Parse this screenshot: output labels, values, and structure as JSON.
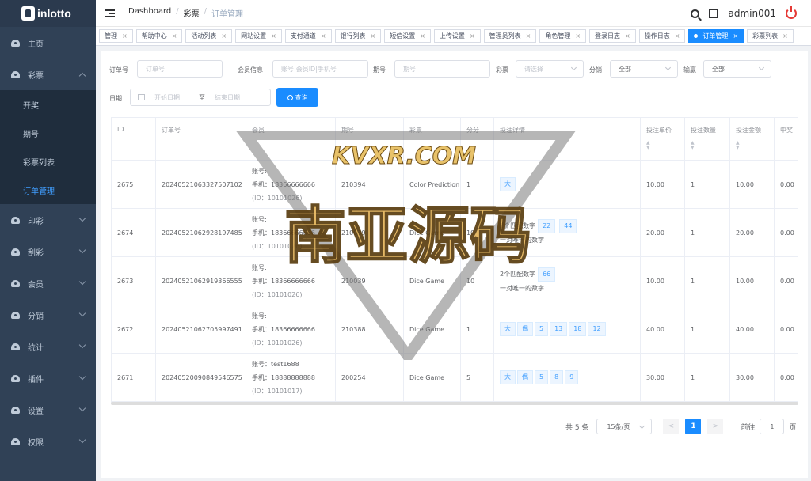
{
  "app": {
    "name": "inlotto"
  },
  "sidebar": {
    "items": [
      {
        "label": "主页",
        "icon": "dashboard-icon",
        "has_arrow": false
      },
      {
        "label": "彩票",
        "icon": "dashboard-icon",
        "has_arrow": true,
        "expanded": true,
        "children": [
          {
            "label": "开奖",
            "active": false
          },
          {
            "label": "期号",
            "active": false
          },
          {
            "label": "彩票列表",
            "active": false
          },
          {
            "label": "订单管理",
            "active": true
          }
        ]
      },
      {
        "label": "印彩",
        "icon": "dashboard-icon",
        "has_arrow": true
      },
      {
        "label": "刮彩",
        "icon": "dashboard-icon",
        "has_arrow": true
      },
      {
        "label": "会员",
        "icon": "dashboard-icon",
        "has_arrow": true
      },
      {
        "label": "分销",
        "icon": "dashboard-icon",
        "has_arrow": true
      },
      {
        "label": "统计",
        "icon": "dashboard-icon",
        "has_arrow": true
      },
      {
        "label": "插件",
        "icon": "dashboard-icon",
        "has_arrow": true
      },
      {
        "label": "设置",
        "icon": "dashboard-icon",
        "has_arrow": true
      },
      {
        "label": "权限",
        "icon": "dashboard-icon",
        "has_arrow": true
      }
    ]
  },
  "navbar": {
    "breadcrumb": [
      "Dashboard",
      "彩票",
      "订单管理"
    ],
    "user": "admin001"
  },
  "tags": [
    {
      "label": "管理",
      "active": false
    },
    {
      "label": "帮助中心",
      "active": false
    },
    {
      "label": "活动列表",
      "active": false
    },
    {
      "label": "网站设置",
      "active": false
    },
    {
      "label": "支付通道",
      "active": false
    },
    {
      "label": "银行列表",
      "active": false
    },
    {
      "label": "短信设置",
      "active": false
    },
    {
      "label": "上传设置",
      "active": false
    },
    {
      "label": "管理员列表",
      "active": false
    },
    {
      "label": "角色管理",
      "active": false
    },
    {
      "label": "登录日志",
      "active": false
    },
    {
      "label": "操作日志",
      "active": false
    },
    {
      "label": "订单管理",
      "active": true
    },
    {
      "label": "彩票列表",
      "active": false
    }
  ],
  "filters": {
    "order_no": {
      "label": "订单号",
      "placeholder": "订单号"
    },
    "member": {
      "label": "会员信息",
      "placeholder": "账号|会员ID|手机号"
    },
    "issue": {
      "label": "期号",
      "placeholder": "期号"
    },
    "lottery": {
      "label": "彩票",
      "placeholder": "请选择"
    },
    "distribution": {
      "label": "分销",
      "value": "全部"
    },
    "win": {
      "label": "输赢",
      "value": "全部"
    },
    "date": {
      "label": "日期",
      "start_placeholder": "开始日期",
      "separator": "至",
      "end_placeholder": "结束日期"
    },
    "search_button": "查询"
  },
  "table": {
    "columns": [
      "ID",
      "订单号",
      "会员",
      "期号",
      "彩票",
      "分分",
      "投注详情",
      "投注单价",
      "投注数量",
      "投注金额",
      "中奖"
    ],
    "rows": [
      {
        "id": "2675",
        "order_no": "20240521063327507102",
        "member": [
          "账号:",
          "手机：18366666666",
          "(ID：10101026)"
        ],
        "issue": "210394",
        "lottery": "Color Prediction",
        "fen": "1",
        "detail_lines": [],
        "badges": [
          "大"
        ],
        "price": "10.00",
        "qty": "1",
        "amount": "10.00",
        "win": "0.00"
      },
      {
        "id": "2674",
        "order_no": "20240521062928197485",
        "member": [
          "账号:",
          "手机：18366666666",
          "(ID：10101026)"
        ],
        "issue": "210039",
        "lottery": "Dice Game",
        "fen": "10",
        "detail_lines": [
          "2个匹配数字",
          "一对唯一的数字"
        ],
        "badges": [
          "22",
          "44"
        ],
        "price": "20.00",
        "qty": "1",
        "amount": "20.00",
        "win": "0.00"
      },
      {
        "id": "2673",
        "order_no": "20240521062919366555",
        "member": [
          "账号:",
          "手机：18366666666",
          "(ID：10101026)"
        ],
        "issue": "210039",
        "lottery": "Dice Game",
        "fen": "10",
        "detail_lines": [
          "2个匹配数字",
          "一对唯一的数字"
        ],
        "badges": [
          "66"
        ],
        "price": "10.00",
        "qty": "1",
        "amount": "10.00",
        "win": "0.00"
      },
      {
        "id": "2672",
        "order_no": "20240521062705997491",
        "member": [
          "账号:",
          "手机：18366666666",
          "(ID：10101026)"
        ],
        "issue": "210388",
        "lottery": "Dice Game",
        "fen": "1",
        "detail_lines": [],
        "badges": [
          "大",
          "偶",
          "5",
          "13",
          "18",
          "12"
        ],
        "price": "40.00",
        "qty": "1",
        "amount": "40.00",
        "win": "0.00"
      },
      {
        "id": "2671",
        "order_no": "20240520090849546575",
        "member": [
          "账号：test1688",
          "手机：18888888888",
          "(ID：10101017)"
        ],
        "issue": "200254",
        "lottery": "Dice Game",
        "fen": "5",
        "detail_lines": [],
        "badges": [
          "大",
          "偶",
          "5",
          "8",
          "9"
        ],
        "price": "30.00",
        "qty": "1",
        "amount": "30.00",
        "win": "0.00"
      }
    ]
  },
  "pagination": {
    "total": "共 5 条",
    "page_size": "15条/页",
    "current": "1",
    "goto_label": "前往",
    "goto_value": "1",
    "page_unit": "页",
    "prev": "<",
    "next": ">"
  },
  "watermark": {
    "top": "KVXR.COM",
    "main": "南亚源码"
  },
  "colors": {
    "sidebar_bg": "#304156",
    "accent": "#1a8cff",
    "power": "#e53935"
  }
}
